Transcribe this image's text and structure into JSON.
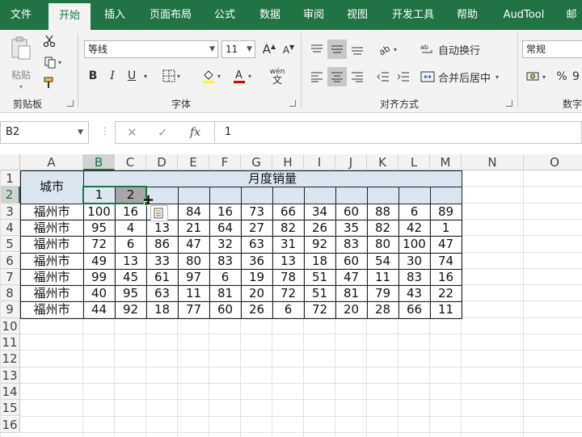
{
  "tabs": [
    "文件",
    "开始",
    "插入",
    "页面布局",
    "公式",
    "数据",
    "审阅",
    "视图",
    "开发工具",
    "帮助",
    "AudTool",
    "邮"
  ],
  "ribbon": {
    "clipboard": {
      "label": "剪贴板",
      "paste": "粘贴"
    },
    "font": {
      "label": "字体",
      "font_name": "等线",
      "font_size": "11",
      "bold": "B",
      "italic": "I",
      "underline": "U",
      "wen": "wén",
      "wen2": "文"
    },
    "align": {
      "label": "对齐方式",
      "wrap": "自动换行",
      "merge": "合并后居中"
    },
    "number": {
      "label": "数字",
      "format": "常规",
      "percent": "%",
      "comma": "9"
    }
  },
  "formula_bar": {
    "name_box": "B2",
    "cancel": "✕",
    "enter": "✓",
    "fx": "fx",
    "value": "1"
  },
  "columns": [
    "A",
    "B",
    "C",
    "D",
    "E",
    "F",
    "G",
    "H",
    "I",
    "J",
    "K",
    "L",
    "M",
    "N",
    "O"
  ],
  "rows": [
    "1",
    "2",
    "3",
    "4",
    "5",
    "6",
    "7",
    "8",
    "9",
    "10",
    "11",
    "12",
    "13",
    "14",
    "15",
    "16"
  ],
  "table": {
    "city_header": "城市",
    "sales_header": "月度销量",
    "row2": [
      "1",
      "2"
    ],
    "data": [
      {
        "city": "福州市",
        "values": [
          "100",
          "16",
          "",
          "84",
          "16",
          "73",
          "66",
          "34",
          "60",
          "88",
          "6",
          "89"
        ]
      },
      {
        "city": "福州市",
        "values": [
          "95",
          "4",
          "13",
          "21",
          "64",
          "27",
          "82",
          "26",
          "35",
          "82",
          "42",
          "1"
        ]
      },
      {
        "city": "福州市",
        "values": [
          "72",
          "6",
          "86",
          "47",
          "32",
          "63",
          "31",
          "92",
          "83",
          "80",
          "100",
          "47"
        ]
      },
      {
        "city": "福州市",
        "values": [
          "49",
          "13",
          "33",
          "80",
          "83",
          "36",
          "13",
          "18",
          "60",
          "54",
          "30",
          "74"
        ]
      },
      {
        "city": "福州市",
        "values": [
          "99",
          "45",
          "61",
          "97",
          "6",
          "19",
          "78",
          "51",
          "47",
          "11",
          "83",
          "16"
        ]
      },
      {
        "city": "福州市",
        "values": [
          "40",
          "95",
          "63",
          "11",
          "81",
          "20",
          "72",
          "51",
          "81",
          "79",
          "43",
          "22"
        ]
      },
      {
        "city": "福州市",
        "values": [
          "44",
          "92",
          "18",
          "77",
          "60",
          "26",
          "6",
          "72",
          "20",
          "28",
          "66",
          "11"
        ]
      }
    ]
  },
  "colors": {
    "accent": "#217346",
    "header_fill": "#dce6f1"
  }
}
